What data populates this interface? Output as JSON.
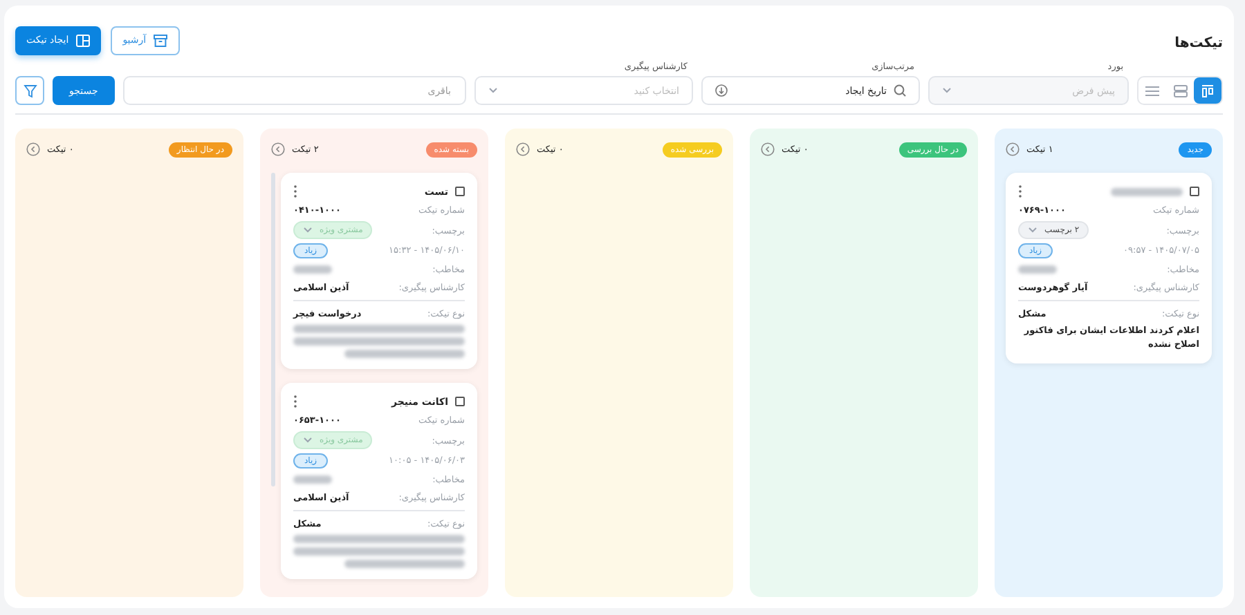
{
  "header": {
    "title": "تیکت‌ها",
    "buttons": [
      {
        "kind": "outline",
        "label": "آرشیو"
      },
      {
        "kind": "primary",
        "label": "ایجاد تیکت"
      }
    ]
  },
  "filters": {
    "views": [
      {
        "kind": "board",
        "selected": true
      },
      {
        "kind": "rows",
        "selected": false
      },
      {
        "kind": "list",
        "selected": false
      }
    ],
    "board": {
      "label": "بورد",
      "placeholder": "پیش فرض"
    },
    "sort": {
      "label": "مرتب‌سازی",
      "value": "تاریخ ایجاد"
    },
    "expert": {
      "label": "کارشناس پیگیری",
      "placeholder": "انتخاب کنید"
    },
    "search": {
      "placeholder": "باقری"
    },
    "search_button": "جستجو"
  },
  "columns": [
    {
      "status": "جدید",
      "color": "#1e96f0",
      "count": "۱ تیکت",
      "tickets": [
        {
          "checked": false,
          "number_label": "شماره تیکت",
          "number": "۰۷۶۹-۱۰۰۰",
          "tag_label": "برچسب:",
          "tag": {
            "kind": "count",
            "text": "۲ برچسب"
          },
          "priority": "زیاد",
          "datetime": "۱۴۰۵/۰۷/۰۵ - ۰۹:۵۷",
          "contact_label": "مخاطب:",
          "expert_label": "کارشناس پیگیری:",
          "expert": "آیار گوهردوست",
          "type_label": "نوع تیکت:",
          "type": "مشکل",
          "description": "اعلام کردند اطلاعات ایشان برای فاکتور اصلاح نشده"
        }
      ]
    },
    {
      "status": "در حال بررسی",
      "color": "#3cc47c",
      "count": "۰ تیکت"
    },
    {
      "status": "بررسی شده",
      "color": "#f5cc20",
      "count": "۰ تیکت"
    },
    {
      "status": "بسته شده",
      "color": "#f78c6c",
      "count": "۲ تیکت",
      "tickets": [
        {
          "checked": false,
          "title": "تست",
          "number_label": "شماره تیکت",
          "number": "۰۴۱۰-۱۰۰۰",
          "tag_label": "برچسب:",
          "tag": {
            "kind": "special",
            "text": "مشتری ویژه"
          },
          "priority": "زیاد",
          "datetime": "۱۴۰۵/۰۶/۱۰ - ۱۵:۳۲",
          "contact_label": "مخاطب:",
          "expert_label": "کارشناس پیگیری:",
          "expert": "آذین اسلامی",
          "type_label": "نوع تیکت:",
          "type": "درخواست فیچر"
        },
        {
          "checked": false,
          "title": "اکانت منیجر",
          "number_label": "شماره تیکت",
          "number": "۰۶۵۳-۱۰۰۰",
          "tag_label": "برچسب:",
          "tag": {
            "kind": "special",
            "text": "مشتری ویژه"
          },
          "priority": "زیاد",
          "datetime": "۱۴۰۵/۰۶/۰۳ - ۱۰:۰۵",
          "contact_label": "مخاطب:",
          "expert_label": "کارشناس پیگیری:",
          "expert": "آذین اسلامی",
          "type_label": "نوع تیکت:",
          "type": "مشکل"
        }
      ]
    },
    {
      "status": "در حال انتظار",
      "color": "#f29a1f",
      "count": "۰ تیکت"
    }
  ]
}
